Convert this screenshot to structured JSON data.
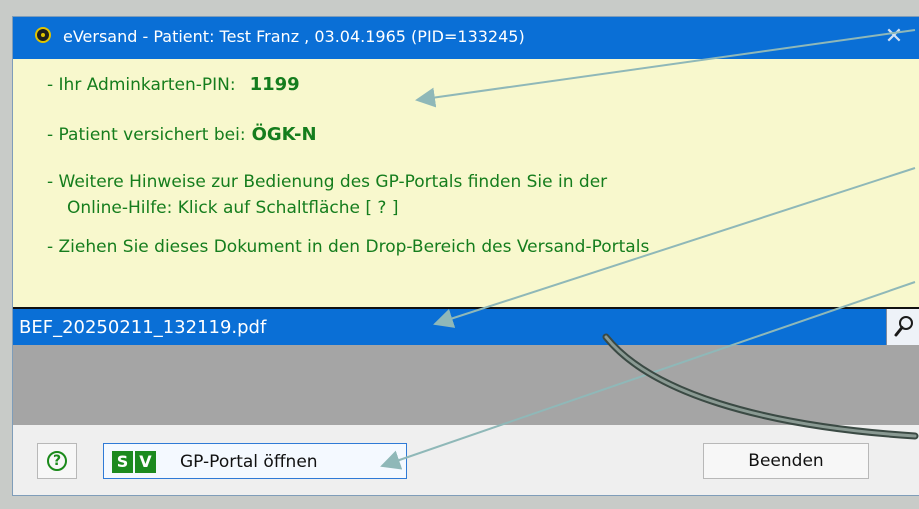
{
  "window": {
    "title": "eVersand - Patient: Test Franz , 03.04.1965 (PID=133245)",
    "close_glyph": "✕"
  },
  "info": {
    "pin_label": "- Ihr Adminkarten-PIN:",
    "pin_value": "1199",
    "insurance_label": "- Patient versichert bei:",
    "insurance_value": "ÖGK-N",
    "hint_line1": "- Weitere Hinweise zur Bedienung des GP-Portals finden Sie in der",
    "hint_line2": "Online-Hilfe:  Klick auf Schaltfläche [ ? ]",
    "drag_hint": "- Ziehen Sie dieses Dokument in den Drop-Bereich des Versand-Portals"
  },
  "file": {
    "name": "BEF_20250211_132119.pdf"
  },
  "buttons": {
    "help_glyph": "?",
    "sv_logo": [
      "S",
      "V"
    ],
    "gp_portal": "GP-Portal öffnen",
    "exit": "Beenden"
  },
  "colors": {
    "titlebar": "#0a6fd6",
    "info_bg": "#f8f8cd",
    "info_text": "#157d1d",
    "drop_area": "#a5a5a5",
    "annotation": "#8fb8b8"
  },
  "icons": [
    "app-icon",
    "close-icon",
    "magnifier-icon",
    "help-icon",
    "sv-logo-icon"
  ]
}
